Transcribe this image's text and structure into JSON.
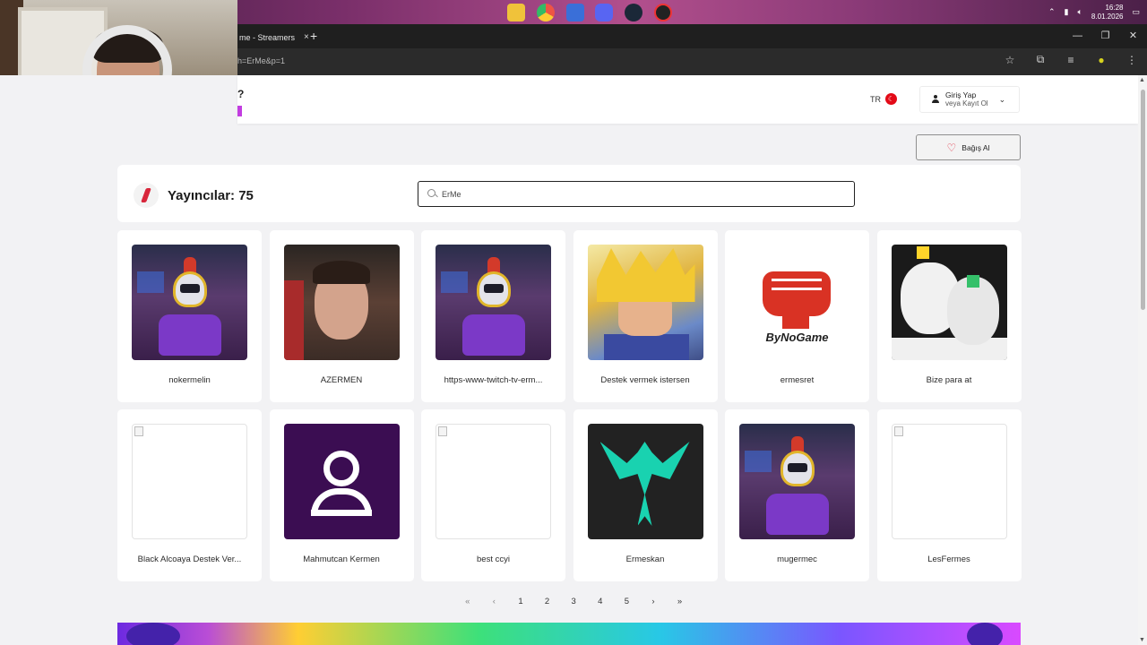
{
  "os": {
    "clock_time": "16:28",
    "clock_date": "8.01.2026"
  },
  "browser": {
    "tab_title": "me - Streamers",
    "tab_close": "×",
    "new_tab": "+",
    "url": "h=ErMe&p=1",
    "window_controls": [
      "—",
      "❐",
      "✕"
    ]
  },
  "header": {
    "lang_code": "TR",
    "login_line1": "Giriş Yap",
    "login_line2": "veya Kayıt Ol",
    "donate_label": "Bağış Al"
  },
  "search": {
    "count_label": "Yayıncılar: 75",
    "query": "ErMe"
  },
  "streamers": [
    {
      "name": "nokermelin",
      "avatar": "knight"
    },
    {
      "name": "AZERMEN",
      "avatar": "person"
    },
    {
      "name": "https-www-twitch-tv-erm...",
      "avatar": "knight"
    },
    {
      "name": "Destek vermek istersen",
      "avatar": "goku"
    },
    {
      "name": "ermesret",
      "avatar": "bynd"
    },
    {
      "name": "Bize para at",
      "avatar": "sketch"
    },
    {
      "name": "Black Alcoaya Destek Ver...",
      "avatar": "broken"
    },
    {
      "name": "Mahmutcan Kermen",
      "avatar": "default-user"
    },
    {
      "name": "best ccyi",
      "avatar": "broken"
    },
    {
      "name": "Ermeskan",
      "avatar": "phoenix"
    },
    {
      "name": "mugermec",
      "avatar": "knight"
    },
    {
      "name": "LesFermes",
      "avatar": "broken"
    }
  ],
  "avatar_texts": {
    "bynd_logo": "ByNoGame"
  },
  "pagination": {
    "first": "«",
    "prev": "‹",
    "pages": [
      "1",
      "2",
      "3",
      "4",
      "5"
    ],
    "next": "›",
    "last": "»"
  },
  "colors": {
    "accent_red": "#e03a4a",
    "brand_purple": "#c23de0"
  }
}
